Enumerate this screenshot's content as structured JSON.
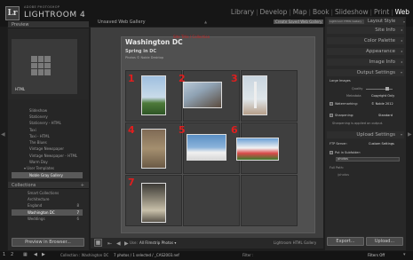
{
  "app": {
    "brand_line": "ADOBE PHOTOSHOP",
    "name": "LIGHTROOM 4",
    "logo": "Lr"
  },
  "modules": [
    "Library",
    "Develop",
    "Map",
    "Book",
    "Slideshow",
    "Print",
    "Web"
  ],
  "active_module": "Web",
  "left_panel": {
    "preview_label": "Preview",
    "preview_badge": "HTML",
    "templates": [
      "Slideshow",
      "Stationery",
      "Stationery - HTML",
      "Taxi",
      "Taxi - HTML",
      "The Blues",
      "Vintage Newspaper",
      "Vintage Newspaper - HTML",
      "Warm Day"
    ],
    "user_templates_label": "User Templates",
    "selected_template": "Noble Gray Gallery",
    "collections_label": "Collections",
    "collections": [
      {
        "name": "Smart Collections",
        "count": ""
      },
      {
        "name": "Architecture",
        "count": ""
      },
      {
        "name": "England",
        "count": "8"
      },
      {
        "name": "Washington DC",
        "count": "7"
      },
      {
        "name": "Weddings",
        "count": "6"
      }
    ],
    "preview_in_browser": "Preview in Browser..."
  },
  "right_panel": {
    "layout_style": "Layout Style",
    "style_name": "Lightroom HTML Gallery",
    "sections": [
      "Site Info",
      "Color Palette",
      "Appearance",
      "Image Info",
      "Output Settings"
    ],
    "large_images_label": "Large Images",
    "quality_label": "Quality",
    "metadata_label": "Metadata",
    "metadata_value": "Copyright Only",
    "watermarking_label": "Watermarking:",
    "watermark_value": "© Noble 2012",
    "sharpening_label": "Sharpening:",
    "sharpening_value": "Standard",
    "sharpening_note": "Sharpening is applied on output.",
    "upload_settings": "Upload Settings",
    "ftp_server_label": "FTP Server:",
    "ftp_server_value": "Custom Settings",
    "put_in_subfolder": "Put in Subfolder:",
    "subfolder_value": "photos",
    "full_path_label": "Full Path:",
    "full_path_value": "/photos",
    "export_button": "Export...",
    "upload_button": "Upload..."
  },
  "center": {
    "tab_title": "Unsaved Web Gallery",
    "save_button": "Create Saved Web Gallery",
    "header_red": "Site Title / Collection",
    "site_title": "Washington DC",
    "collection_title": "Spring in DC",
    "subtitle": "Photos © Noble Desktop",
    "cell_numbers": [
      "1",
      "2",
      "3",
      "4",
      "5",
      "6",
      "7"
    ],
    "use_label": "Use:",
    "use_value": "All Filmstrip Photos",
    "gallery_type": "Lightroom HTML Gallery"
  },
  "filmstrip_bar": {
    "collection_text": "Collection : Washington DC",
    "count_text": "7 photos / 1 selected / _CAS2003.nef",
    "filter_label": "Filter :",
    "filter_value": "Filters Off"
  },
  "colors": {
    "accent_red": "#e01e1e",
    "active_module": "#ffffff",
    "bg": "#1e1e1e"
  }
}
